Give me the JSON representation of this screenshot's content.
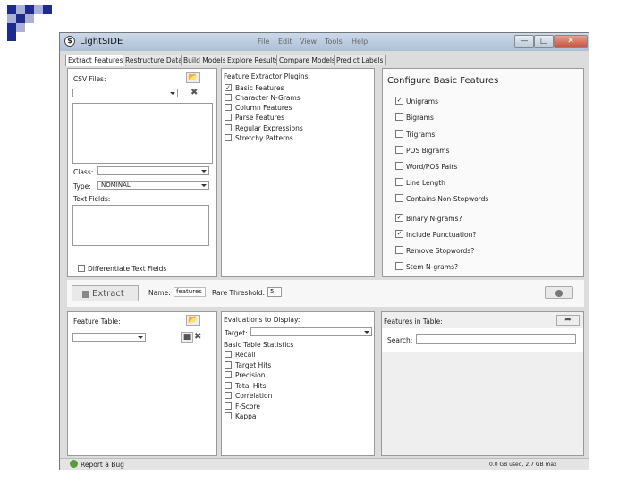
{
  "app": {
    "title": "LightSIDE",
    "logo_glyph": "$"
  },
  "menu": [
    "File",
    "Edit",
    "View",
    "Tools",
    "Help"
  ],
  "window_buttons": {
    "minimize": "—",
    "maximize": "□",
    "close": "✕"
  },
  "tabs": [
    "Extract Features",
    "Restructure Data",
    "Build Models",
    "Explore Results",
    "Compare Models",
    "Predict Labels"
  ],
  "left": {
    "csv_files_label": "CSV Files:",
    "class_label": "Class:",
    "type_label": "Type:",
    "type_value": "NOMINAL",
    "text_fields_label": "Text Fields:",
    "differentiate_label": "Differentiate Text Fields"
  },
  "plugins": {
    "header": "Feature Extractor Plugins:",
    "items": [
      {
        "label": "Basic Features",
        "checked": true
      },
      {
        "label": "Character N-Grams",
        "checked": false
      },
      {
        "label": "Column Features",
        "checked": false
      },
      {
        "label": "Parse Features",
        "checked": false
      },
      {
        "label": "Regular Expressions",
        "checked": false
      },
      {
        "label": "Stretchy Patterns",
        "checked": false
      }
    ]
  },
  "configure": {
    "title": "Configure Basic Features",
    "options": [
      {
        "label": "Unigrams",
        "checked": true
      },
      {
        "label": "Bigrams",
        "checked": false
      },
      {
        "label": "Trigrams",
        "checked": false
      },
      {
        "label": "POS Bigrams",
        "checked": false
      },
      {
        "label": "Word/POS Pairs",
        "checked": false
      },
      {
        "label": "Line Length",
        "checked": false
      },
      {
        "label": "Contains Non-Stopwords",
        "checked": false
      },
      {
        "label": "Binary N-grams?",
        "checked": true
      },
      {
        "label": "Include Punctuation?",
        "checked": true
      },
      {
        "label": "Remove Stopwords?",
        "checked": false
      },
      {
        "label": "Stem N-grams?",
        "checked": false
      }
    ]
  },
  "extract": {
    "button_label": "Extract",
    "name_label": "Name:",
    "name_value": "features",
    "rare_label": "Rare Threshold:",
    "rare_value": "5"
  },
  "bottom_left": {
    "feature_table_label": "Feature Table:"
  },
  "evaluations": {
    "header": "Evaluations to Display:",
    "target_label": "Target:",
    "stats_header": "Basic Table Statistics",
    "items": [
      "Recall",
      "Target Hits",
      "Precision",
      "Total Hits",
      "Correlation",
      "F-Score",
      "Kappa"
    ]
  },
  "features_in_table": {
    "label": "Features in Table:",
    "search_label": "Search:"
  },
  "status": {
    "bug_label": "Report a Bug",
    "memory": "0.0 GB used, 2.7 GB max"
  },
  "colors": {
    "bullet_dark": "#1c2b8c",
    "bullet_light": "#aab0d6",
    "title_gradient_top": "#cbd9ea",
    "close_red": "#c55038"
  }
}
